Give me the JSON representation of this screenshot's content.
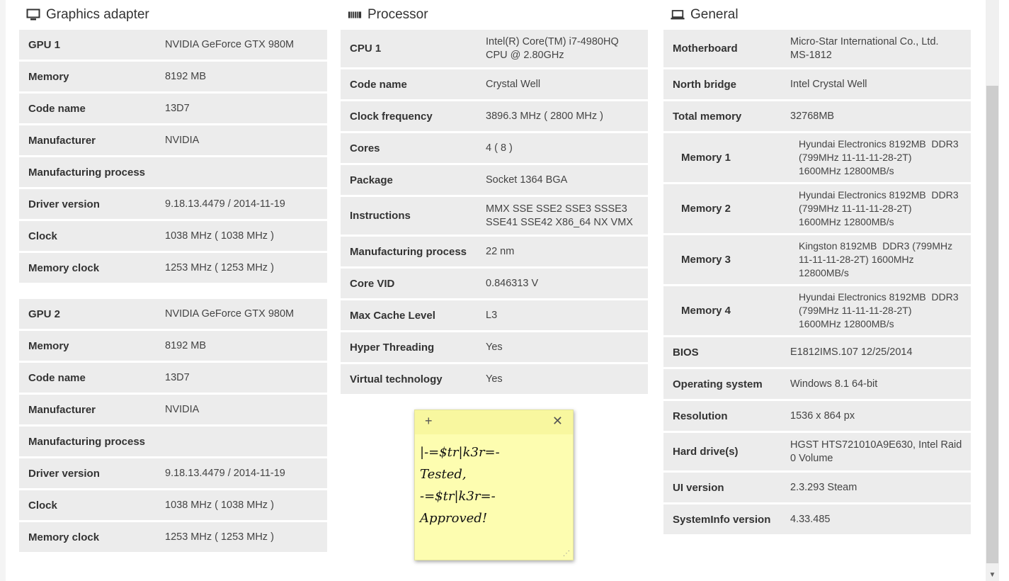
{
  "sections": {
    "graphics": {
      "title": "Graphics adapter",
      "icon": "monitor-icon"
    },
    "processor": {
      "title": "Processor",
      "icon": "cpu-chip-icon"
    },
    "general": {
      "title": "General",
      "icon": "laptop-icon"
    }
  },
  "gpu1": [
    {
      "label": "GPU 1",
      "value": "NVIDIA GeForce GTX 980M"
    },
    {
      "label": "Memory",
      "value": "8192 MB"
    },
    {
      "label": "Code name",
      "value": "13D7"
    },
    {
      "label": "Manufacturer",
      "value": "NVIDIA"
    },
    {
      "label": "Manufacturing process",
      "value": ""
    },
    {
      "label": "Driver version",
      "value": "9.18.13.4479 / 2014-11-19"
    },
    {
      "label": "Clock",
      "value": "1038 MHz ( 1038 MHz )"
    },
    {
      "label": "Memory clock",
      "value": "1253 MHz ( 1253 MHz )"
    }
  ],
  "gpu2": [
    {
      "label": "GPU 2",
      "value": "NVIDIA GeForce GTX 980M"
    },
    {
      "label": "Memory",
      "value": "8192 MB"
    },
    {
      "label": "Code name",
      "value": "13D7"
    },
    {
      "label": "Manufacturer",
      "value": "NVIDIA"
    },
    {
      "label": "Manufacturing process",
      "value": ""
    },
    {
      "label": "Driver version",
      "value": "9.18.13.4479 / 2014-11-19"
    },
    {
      "label": "Clock",
      "value": "1038 MHz ( 1038 MHz )"
    },
    {
      "label": "Memory clock",
      "value": "1253 MHz ( 1253 MHz )"
    }
  ],
  "processor": [
    {
      "label": "CPU 1",
      "value": "Intel(R) Core(TM) i7-4980HQ\nCPU @ 2.80GHz"
    },
    {
      "label": "Code name",
      "value": "Crystal Well"
    },
    {
      "label": "Clock frequency",
      "value": "3896.3 MHz ( 2800 MHz )"
    },
    {
      "label": "Cores",
      "value": "4 ( 8 )"
    },
    {
      "label": "Package",
      "value": "Socket 1364 BGA"
    },
    {
      "label": "Instructions",
      "value": "MMX SSE SSE2 SSE3 SSSE3\nSSE41 SSE42 X86_64 NX VMX"
    },
    {
      "label": "Manufacturing process",
      "value": "22 nm"
    },
    {
      "label": "Core VID",
      "value": "0.846313 V"
    },
    {
      "label": "Max Cache Level",
      "value": "L3"
    },
    {
      "label": "Hyper Threading",
      "value": "Yes"
    },
    {
      "label": "Virtual technology",
      "value": "Yes"
    }
  ],
  "general": [
    {
      "label": "Motherboard",
      "value": "Micro-Star International Co., Ltd.\nMS-1812"
    },
    {
      "label": "North bridge",
      "value": "Intel Crystal Well"
    },
    {
      "label": "Total memory",
      "value": "32768MB"
    },
    {
      "label": "Memory 1",
      "value": "Hyundai Electronics 8192MB  DDR3\n(799MHz 11-11-11-28-2T)\n1600MHz 12800MB/s"
    },
    {
      "label": "Memory 2",
      "value": "Hyundai Electronics 8192MB  DDR3\n(799MHz 11-11-11-28-2T)\n1600MHz 12800MB/s"
    },
    {
      "label": "Memory 3",
      "value": "Kingston 8192MB  DDR3 (799MHz\n11-11-11-28-2T) 1600MHz\n12800MB/s"
    },
    {
      "label": "Memory 4",
      "value": "Hyundai Electronics 8192MB  DDR3\n(799MHz 11-11-11-28-2T)\n1600MHz 12800MB/s"
    },
    {
      "label": "BIOS",
      "value": "E1812IMS.107 12/25/2014"
    },
    {
      "label": "Operating system",
      "value": "Windows 8.1 64-bit"
    },
    {
      "label": "Resolution",
      "value": "1536 x 864 px"
    },
    {
      "label": "Hard drive(s)",
      "value": "HGST HTS721010A9E630, Intel Raid\n0 Volume"
    },
    {
      "label": "UI version",
      "value": "2.3.293 Steam"
    },
    {
      "label": "SystemInfo version",
      "value": "4.33.485"
    }
  ],
  "sticky_note": {
    "text": "|-=$tr|k3r=-\nTested,\n-=$tr|k3r=-\nApproved!",
    "add_symbol": "+",
    "close_symbol": "✕"
  }
}
